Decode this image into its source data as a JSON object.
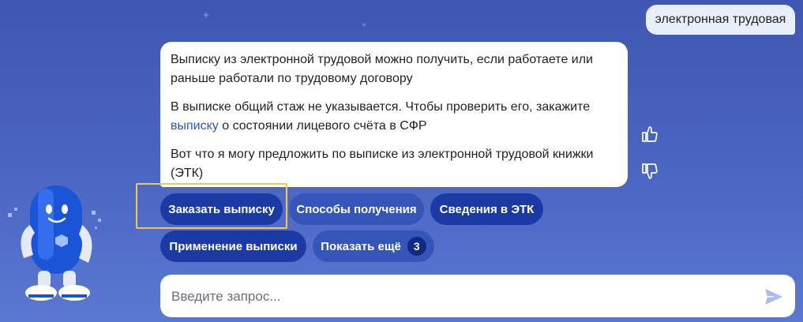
{
  "chat": {
    "user_message": "электронная трудовая",
    "bot_message": {
      "p1": "Выписку из электронной трудовой можно получить, если работаете или раньше работали по трудовому договору",
      "p2_before": "В выписке общий стаж не указывается. Чтобы проверить его, закажите ",
      "p2_link": "выписку",
      "p2_after": " о состоянии лицевого счёта в СФР",
      "p3": "Вот что я могу предложить по выписке из электронной трудовой книжки (ЭТК)"
    }
  },
  "suggestions": {
    "order": "Заказать выписку",
    "methods": "Способы получения",
    "info": "Сведения в ЭТК",
    "usage": "Применение выписки",
    "more": "Показать ещё",
    "more_count": "3"
  },
  "input": {
    "placeholder": "Введите запрос..."
  },
  "colors": {
    "accent": "#1c3aa3",
    "highlight": "#f2c94c",
    "link": "#2d56c5"
  },
  "icons": [
    "thumbs-up-icon",
    "thumbs-down-icon",
    "send-icon",
    "robot-assistant"
  ]
}
